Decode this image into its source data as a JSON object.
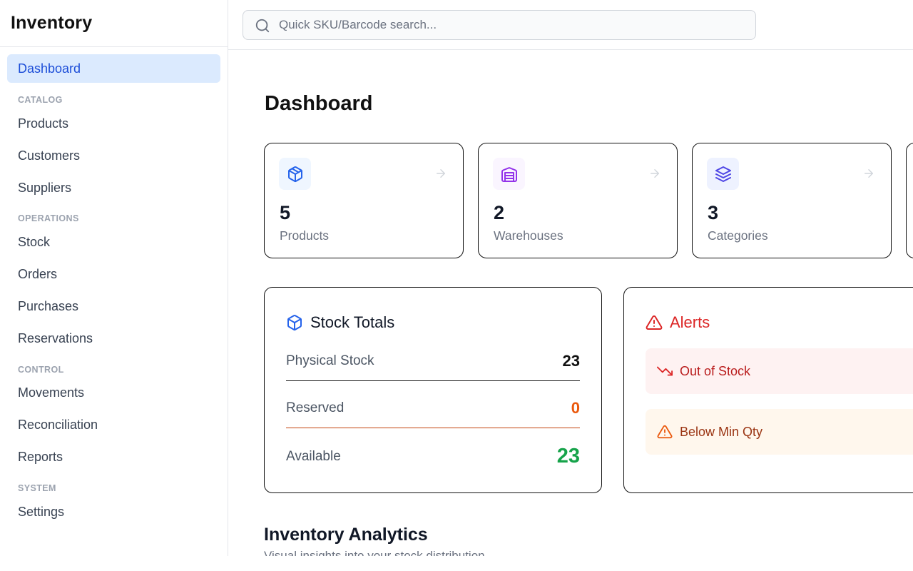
{
  "app": {
    "title": "Inventory"
  },
  "sidebar": {
    "items": [
      {
        "label": "Dashboard",
        "active": true
      },
      {
        "section": "CATALOG"
      },
      {
        "label": "Products"
      },
      {
        "label": "Customers"
      },
      {
        "label": "Suppliers"
      },
      {
        "section": "OPERATIONS"
      },
      {
        "label": "Stock"
      },
      {
        "label": "Orders"
      },
      {
        "label": "Purchases"
      },
      {
        "label": "Reservations"
      },
      {
        "section": "CONTROL"
      },
      {
        "label": "Movements"
      },
      {
        "label": "Reconciliation"
      },
      {
        "label": "Reports"
      },
      {
        "section": "SYSTEM"
      },
      {
        "label": "Settings"
      }
    ]
  },
  "search": {
    "placeholder": "Quick SKU/Barcode search...",
    "icon": "search-icon"
  },
  "main": {
    "title": "Dashboard",
    "stats": [
      {
        "value": "5",
        "label": "Products",
        "icon": "box-icon",
        "icon_color": "#2563eb",
        "icon_bg": "#eff6ff"
      },
      {
        "value": "2",
        "label": "Warehouses",
        "icon": "warehouse-icon",
        "icon_color": "#9333ea",
        "icon_bg": "#faf5ff"
      },
      {
        "value": "3",
        "label": "Categories",
        "icon": "layers-icon",
        "icon_color": "#4f46e5",
        "icon_bg": "#eef2ff"
      }
    ],
    "stock_totals": {
      "title": "Stock Totals",
      "rows": [
        {
          "label": "Physical Stock",
          "value": "23",
          "color": "#111111"
        },
        {
          "label": "Reserved",
          "value": "0",
          "color": "#ea580c"
        },
        {
          "label": "Available",
          "value": "23",
          "color": "#16a34a"
        }
      ]
    },
    "alerts": {
      "title": "Alerts",
      "title_color": "#dc2626",
      "items": [
        {
          "label": "Out of Stock",
          "color": "#b91c1c",
          "bg": "#fef2f2",
          "icon": "trending-down-icon"
        },
        {
          "label": "Below Min Qty",
          "color": "#9a3412",
          "bg": "#fff7ed",
          "icon": "warning-icon"
        }
      ]
    },
    "analytics": {
      "title": "Inventory Analytics",
      "subtitle": "Visual insights into your stock distribution"
    }
  }
}
